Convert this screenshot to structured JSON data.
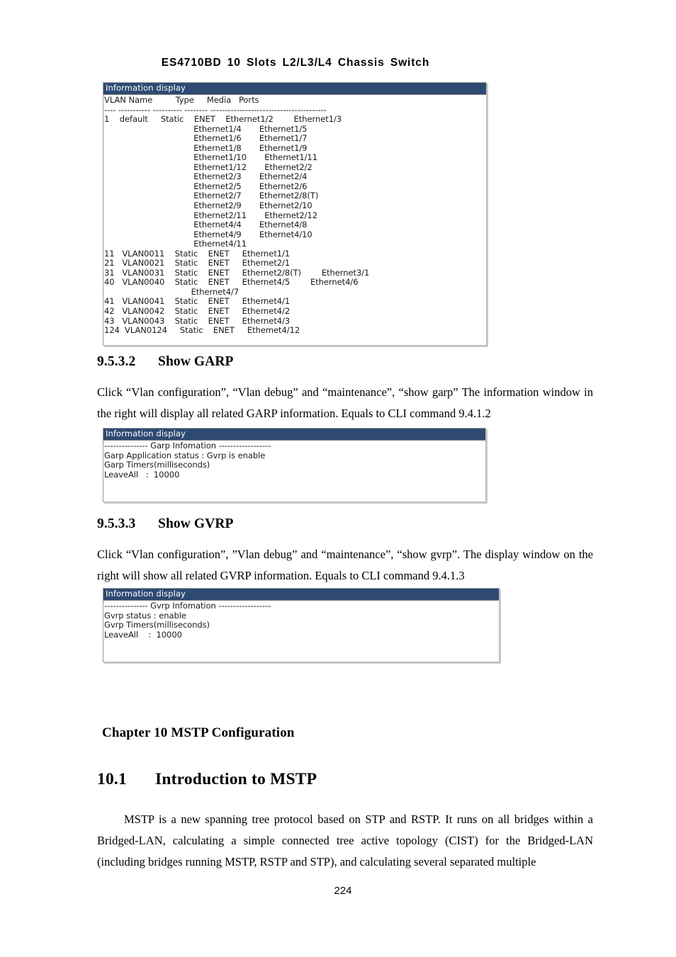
{
  "header": {
    "running_title": "ES4710BD 10 Slots L2/L3/L4 Chassis Switch"
  },
  "windows": {
    "vlan": {
      "title": "Information display",
      "content": "VLAN Name         Type     Media   Ports\n---- ----------- ---------- -------- ----------------------------------------\n1    default     Static    ENET    Ethernet1/2        Ethernet1/3\n                                   Ethernet1/4       Ethernet1/5\n                                   Ethernet1/6       Ethernet1/7\n                                   Ethernet1/8       Ethernet1/9\n                                   Ethernet1/10       Ethernet1/11\n                                   Ethernet1/12       Ethernet2/2\n                                   Ethernet2/3       Ethernet2/4\n                                   Ethernet2/5       Ethernet2/6\n                                   Ethernet2/7       Ethernet2/8(T)\n                                   Ethernet2/9       Ethernet2/10\n                                   Ethernet2/11       Ethernet2/12\n                                   Ethernet4/4       Ethernet4/8\n                                   Ethernet4/9       Ethernet4/10\n                                   Ethernet4/11\n11   VLAN0011    Static    ENET     Ethernet1/1\n21   VLAN0021    Static    ENET     Ethernet2/1\n31   VLAN0031    Static    ENET     Ethernet2/8(T)        Ethernet3/1\n40   VLAN0040    Static    ENET     Ethernet4/5        Ethernet4/6\n                                  Ethernet4/7\n41   VLAN0041    Static    ENET     Ethernet4/1\n42   VLAN0042    Static    ENET     Ethernet4/2\n43   VLAN0043    Static    ENET     Ethernet4/3\n124  VLAN0124     Static    ENET     Ethemet4/12"
    },
    "garp": {
      "title": "Information display",
      "content": "--------------- Garp Infomation ------------------\nGarp Application status : Gvrp is enable\nGarp Timers(milliseconds)\nLeaveAll   :  10000"
    },
    "gvrp": {
      "title": "Information display",
      "content": "--------------- Gvrp Infomation ------------------\nGvrp status : enable\nGvrp Timers(milliseconds)\nLeaveAll    :  10000"
    }
  },
  "sections": {
    "garp": {
      "number": "9.5.3.2",
      "title": "Show GARP",
      "paragraph": "Click “Vlan configuration”, “Vlan debug” and “maintenance”, “show garp” The information window in the right will display all related GARP information. Equals to CLI command 9.4.1.2"
    },
    "gvrp": {
      "number": "9.5.3.3",
      "title": "Show GVRP",
      "paragraph": "Click “Vlan configuration”, ”Vlan debug” and “maintenance”, “show gvrp”. The display window on the right will show all related GVRP information. Equals to CLI command 9.4.1.3"
    },
    "chapter": {
      "title": "Chapter 10 MSTP Configuration"
    },
    "mstp": {
      "number": "10.1",
      "title": "Introduction to MSTP",
      "paragraph": "MSTP is a new spanning tree protocol based on STP and RSTP. It runs on all bridges within a Bridged-LAN, calculating a simple connected tree active topology (CIST) for the Bridged-LAN (including bridges running MSTP, RSTP and STP), and calculating several separated multiple"
    }
  },
  "footer": {
    "page_number": "224"
  }
}
